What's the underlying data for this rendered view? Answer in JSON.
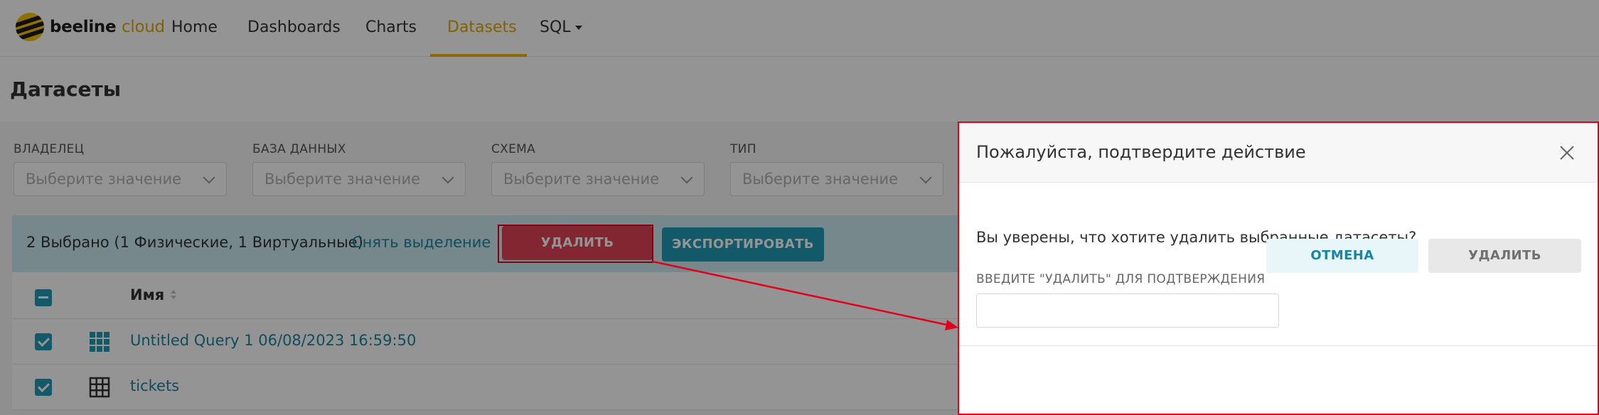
{
  "navbar": {
    "brand": {
      "part1": "beeline",
      "part2": "cloud"
    },
    "items": [
      {
        "label": "Home"
      },
      {
        "label": "Dashboards"
      },
      {
        "label": "Charts"
      },
      {
        "label": "Datasets"
      },
      {
        "label": "SQL"
      }
    ],
    "active_item": "Datasets"
  },
  "page": {
    "title": "Датасеты"
  },
  "filters": [
    {
      "label": "ВЛАДЕЛЕЦ",
      "placeholder": "Выберите значение"
    },
    {
      "label": "БАЗА ДАННЫХ",
      "placeholder": "Выберите значение"
    },
    {
      "label": "СХЕМА",
      "placeholder": "Выберите значение"
    },
    {
      "label": "ТИП",
      "placeholder": "Выберите значение"
    }
  ],
  "bulk_bar": {
    "selected_text": "2 Выбрано (1 Физические, 1 Виртуальные)",
    "deselect_label": "Снять выделение",
    "delete_label": "УДАЛИТЬ",
    "export_label": "ЭКСПОРТИРОВАТЬ"
  },
  "table": {
    "name_header": "Имя",
    "rows": [
      {
        "name": "Untitled Query 1 06/08/2023 16:59:50",
        "kind": "virtual",
        "checked": true
      },
      {
        "name": "tickets",
        "kind": "physical",
        "checked": true
      }
    ]
  },
  "modal": {
    "title": "Пожалуйста, подтвердите действие",
    "question": "Вы уверены, что хотите удалить выбранные датасеты?",
    "input_hint": "ВВЕДИТЕ \"УДАЛИТЬ\" ДЛЯ ПОДТВЕРЖДЕНИЯ",
    "input_value": "",
    "cancel_label": "ОТМЕНА",
    "confirm_label": "УДАЛИТЬ"
  },
  "colors": {
    "brand_yellow": "#f3b400",
    "primary": "#1f9ab5",
    "danger": "#e04355",
    "highlight_red": "#e3001b"
  }
}
